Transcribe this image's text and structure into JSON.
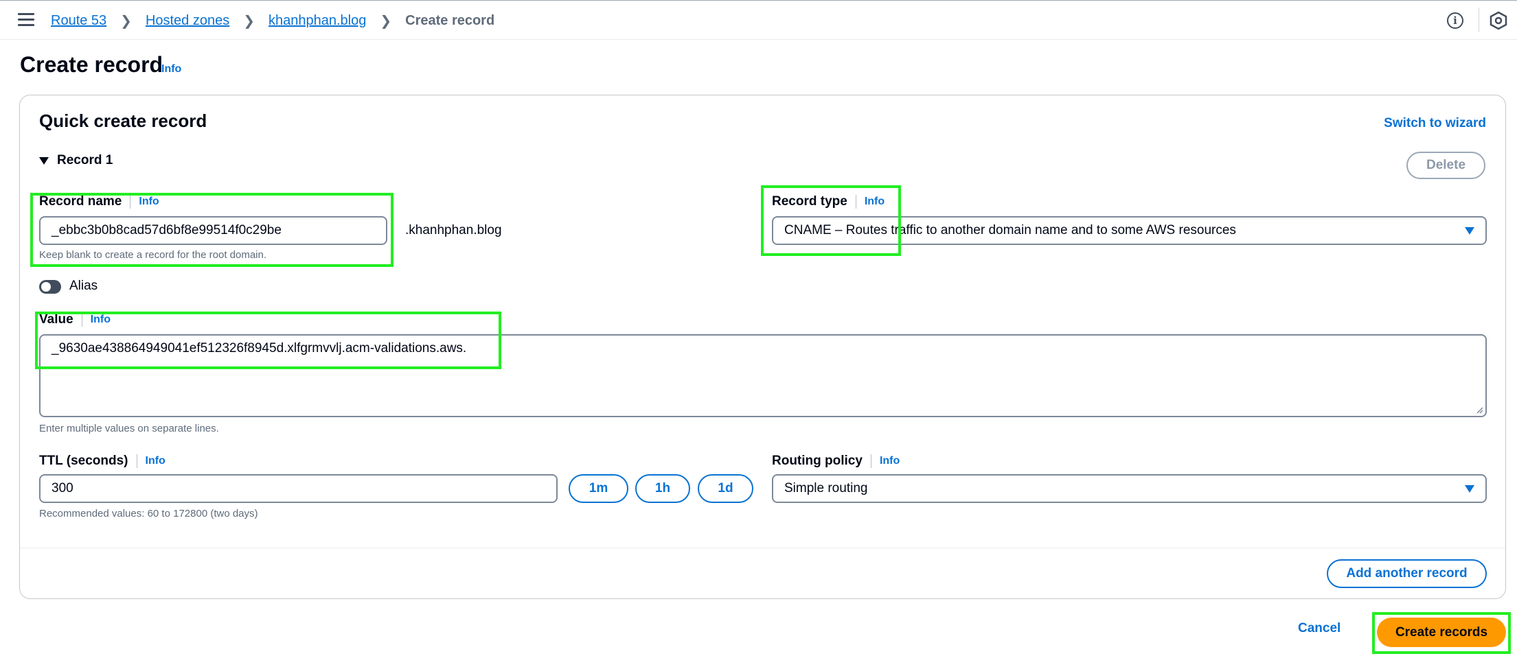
{
  "breadcrumb": {
    "items": [
      "Route 53",
      "Hosted zones",
      "khanhphan.blog"
    ],
    "current": "Create record"
  },
  "page": {
    "title": "Create record",
    "info": "Info"
  },
  "quick_create": {
    "title": "Quick create record",
    "switch_label": "Switch to wizard",
    "record_label": "Record 1",
    "delete_label": "Delete"
  },
  "record_name": {
    "label": "Record name",
    "info": "Info",
    "value": "_ebbc3b0b8cad57d6bf8e99514f0c29be",
    "suffix": ".khanhphan.blog",
    "hint": "Keep blank to create a record for the root domain."
  },
  "record_type": {
    "label": "Record type",
    "info": "Info",
    "value": "CNAME – Routes traffic to another domain name and to some AWS resources"
  },
  "alias": {
    "label": "Alias",
    "enabled": false
  },
  "value_field": {
    "label": "Value",
    "info": "Info",
    "value": "_9630ae438864949041ef512326f8945d.xlfgrmvvlj.acm-validations.aws.",
    "hint": "Enter multiple values on separate lines."
  },
  "ttl": {
    "label": "TTL (seconds)",
    "info": "Info",
    "value": "300",
    "hint": "Recommended values: 60 to 172800 (two days)",
    "presets": [
      "1m",
      "1h",
      "1d"
    ]
  },
  "routing_policy": {
    "label": "Routing policy",
    "info": "Info",
    "value": "Simple routing"
  },
  "actions": {
    "add_another": "Add another record",
    "cancel": "Cancel",
    "create": "Create records"
  },
  "colors": {
    "accent": "#0972d3",
    "primary_button": "#ff9900",
    "highlight": "#22ee22"
  }
}
